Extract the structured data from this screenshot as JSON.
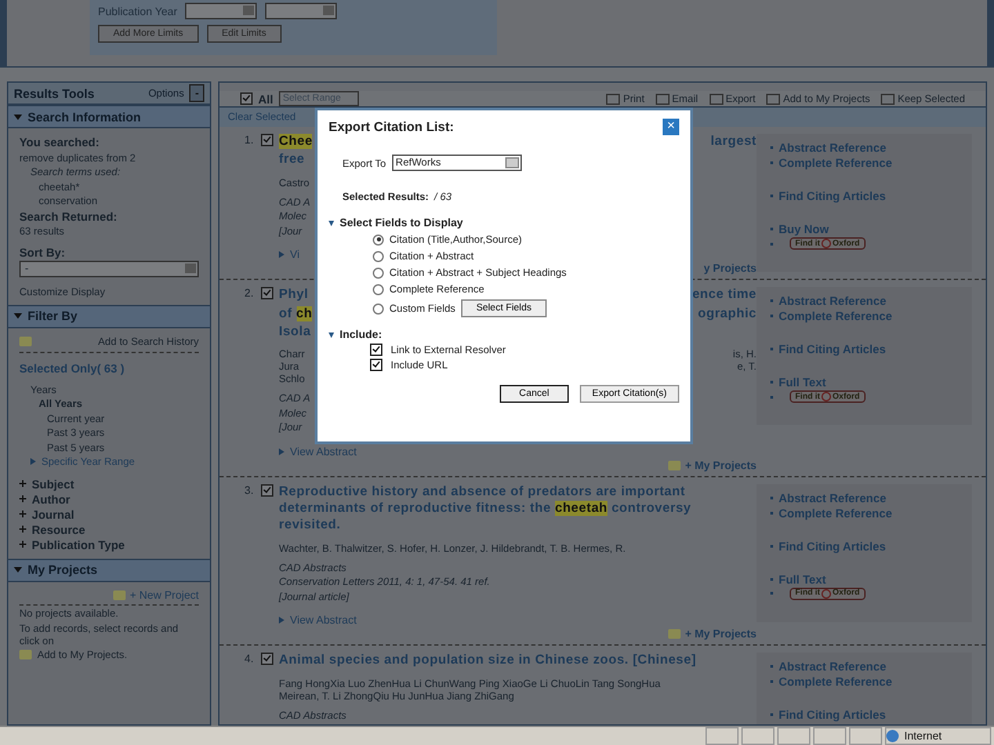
{
  "limits": {
    "label": "Publication Year",
    "buttons": [
      "Add More Limits",
      "Edit Limits"
    ]
  },
  "sidebar": {
    "tools": {
      "title": "Results Tools",
      "options": "Options",
      "collapse": "-"
    },
    "search_info": {
      "title": "Search Information",
      "you_searched": "You searched:",
      "query": "remove duplicates from 2",
      "terms_label": "Search terms used:",
      "terms": [
        "cheetah*",
        "conservation"
      ],
      "returned_label": "Search Returned:",
      "returned": "63 results",
      "sort_label": "Sort By:",
      "sort_value": "-",
      "customize": "Customize Display"
    },
    "filter": {
      "title": "Filter By",
      "history": "Add to Search History",
      "selected_only": "Selected Only( 63 )",
      "years_label": "Years",
      "all_years": "All Years",
      "year_options": [
        "Current year",
        "Past 3 years",
        "Past 5 years"
      ],
      "range": "Specific Year Range",
      "facets": [
        "Subject",
        "Author",
        "Journal",
        "Resource",
        "Publication Type"
      ]
    },
    "projects": {
      "title": "My Projects",
      "new": "+ New Project",
      "empty": "No projects available.",
      "hint": "To add records, select records and click on",
      "add": "Add to My Projects."
    }
  },
  "toolbar": {
    "all_checked": true,
    "all": "All",
    "range_placeholder": "Select Range",
    "actions": [
      "Print",
      "Email",
      "Export",
      "Add to My Projects",
      "Keep Selected"
    ],
    "clear": "Clear Selected"
  },
  "results": [
    {
      "number": "1.",
      "checked": true,
      "title_lines": [
        {
          "left": [
            {
              "text": "Chee",
              "highlight": true
            }
          ],
          "right": [
            {
              "text": "largest",
              "highlight": false
            }
          ]
        },
        {
          "left": [
            {
              "text": "free",
              "highlight": false
            }
          ]
        }
      ],
      "author_lines": [
        {
          "left": "Castro"
        }
      ],
      "source_lines": [
        "CAD A",
        "Molec",
        "[Jour"
      ],
      "view_abstract": "Vi",
      "my_projects": {
        "text": "y Projects",
        "icon": false
      },
      "side": [
        [
          {
            "kind": "link",
            "text": "Abstract Reference"
          },
          {
            "kind": "link",
            "text": "Complete Reference"
          }
        ],
        [
          {
            "kind": "link",
            "text": "Find Citing Articles"
          }
        ],
        [
          {
            "kind": "link",
            "text": "Buy Now"
          },
          {
            "kind": "badge",
            "left": "Find it",
            "right": "Oxford"
          }
        ]
      ]
    },
    {
      "number": "2.",
      "checked": true,
      "title_lines": [
        {
          "left": [
            {
              "text": "Phyl",
              "highlight": false
            }
          ],
          "right": [
            {
              "text": "ence time",
              "highlight": false
            }
          ]
        },
        {
          "left": [
            {
              "text": "of ",
              "highlight": false
            },
            {
              "text": "ch",
              "highlight": true
            }
          ],
          "right": [
            {
              "text": "ographic",
              "highlight": false
            }
          ]
        },
        {
          "left": [
            {
              "text": "Isola",
              "highlight": false
            }
          ]
        }
      ],
      "author_lines": [
        {
          "left": "Charr",
          "right": "is, H."
        },
        {
          "left": "Jura",
          "right": "e, T."
        },
        {
          "left": "Schlo"
        }
      ],
      "source_lines": [
        "CAD A",
        "Molec",
        "[Jour"
      ],
      "view_abstract": "View Abstract",
      "my_projects": {
        "text": "+ My Projects",
        "icon": true
      },
      "side": [
        [
          {
            "kind": "link",
            "text": "Abstract Reference"
          },
          {
            "kind": "link",
            "text": "Complete Reference"
          }
        ],
        [
          {
            "kind": "link",
            "text": "Find Citing Articles"
          }
        ],
        [
          {
            "kind": "link",
            "text": "Full Text"
          },
          {
            "kind": "badge",
            "left": "Find it",
            "right": "Oxford"
          }
        ]
      ]
    },
    {
      "number": "3.",
      "checked": true,
      "title_lines": [
        {
          "left": [
            {
              "text": "Reproductive history and absence of predators are important determinants of reproductive fitness: the ",
              "highlight": false
            },
            {
              "text": "cheetah",
              "highlight": true
            },
            {
              "text": " controversy revisited.",
              "highlight": false
            }
          ]
        }
      ],
      "author_lines": [
        {
          "left": "Wachter, B. Thalwitzer, S. Hofer, H. Lonzer, J. Hildebrandt, T. B. Hermes, R."
        }
      ],
      "source_lines": [
        "CAD Abstracts",
        "Conservation Letters 2011, 4: 1, 47-54. 41 ref.",
        "[Journal article]"
      ],
      "view_abstract": "View Abstract",
      "my_projects": {
        "text": "+ My Projects",
        "icon": true
      },
      "side": [
        [
          {
            "kind": "link",
            "text": "Abstract Reference"
          },
          {
            "kind": "link",
            "text": "Complete Reference"
          }
        ],
        [
          {
            "kind": "link",
            "text": "Find Citing Articles"
          }
        ],
        [
          {
            "kind": "link",
            "text": "Full Text"
          },
          {
            "kind": "badge",
            "left": "Find it",
            "right": "Oxford"
          }
        ]
      ]
    },
    {
      "number": "4.",
      "checked": true,
      "title_lines": [
        {
          "left": [
            {
              "text": "Animal species and population size in Chinese zoos. [Chinese]",
              "highlight": false
            }
          ]
        }
      ],
      "author_lines": [
        {
          "left": "Fang HongXia Luo ZhenHua Li ChunWang Ping XiaoGe Li ChuoLin Tang SongHua"
        },
        {
          "left": "Meirean, T. Li ZhongQiu Hu JunHua Jiang ZhiGang"
        }
      ],
      "source_lines": [
        "CAD Abstracts"
      ],
      "side": [
        [
          {
            "kind": "link",
            "text": "Abstract Reference"
          },
          {
            "kind": "link",
            "text": "Complete Reference"
          }
        ],
        [
          {
            "kind": "link",
            "text": "Find Citing Articles"
          }
        ]
      ]
    }
  ],
  "dialog": {
    "title": "Export Citation List:",
    "close": "×",
    "export_label": "Export To",
    "export_value": "RefWorks",
    "selected_label": "Selected Results:",
    "selected_value": "/ 63",
    "fields_title": "Select Fields to Display",
    "fields": [
      {
        "label": "Citation (Title,Author,Source)",
        "selected": true
      },
      {
        "label": "Citation + Abstract",
        "selected": false
      },
      {
        "label": "Citation + Abstract + Subject Headings",
        "selected": false
      },
      {
        "label": "Complete Reference",
        "selected": false
      },
      {
        "label": "Custom Fields",
        "selected": false,
        "button": "Select Fields"
      }
    ],
    "include_title": "Include:",
    "include": [
      {
        "label": "Link to External Resolver",
        "checked": true
      },
      {
        "label": "Include URL",
        "checked": true
      }
    ],
    "buttons": [
      "Cancel",
      "Export Citation(s)"
    ]
  },
  "status_bar": {
    "zone": "Internet"
  }
}
